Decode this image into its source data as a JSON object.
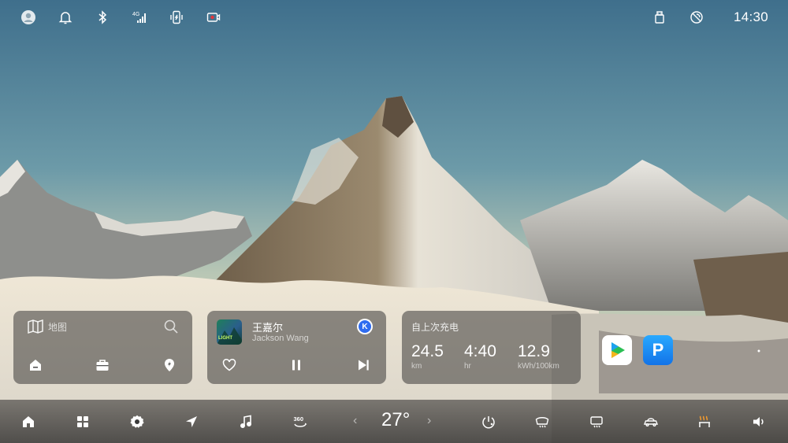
{
  "status_bar": {
    "network_label": "4G",
    "time": "14:30"
  },
  "nav_card": {
    "title": "地图",
    "shortcuts": [
      "home-icon",
      "work-briefcase-icon",
      "poi-location-icon"
    ]
  },
  "music_card": {
    "title": "王嘉尔",
    "artist": "Jackson Wang",
    "album_text": "LIGHT",
    "source_badge": "K",
    "favorite": false,
    "playing": true
  },
  "energy_card": {
    "title": "自上次充电",
    "stats": [
      {
        "value": "24.5",
        "unit": "km"
      },
      {
        "value": "4:40",
        "unit": "hr"
      },
      {
        "value": "12.9",
        "unit": "kWh/100km"
      }
    ]
  },
  "apps": {
    "video_app": "video-play-icon",
    "p_app_label": "P"
  },
  "dock": {
    "camera_label": "360",
    "temperature": "27°",
    "temp_down": "‹",
    "temp_up": "›"
  },
  "colors": {
    "card_bg": "#444240",
    "accent_blue": "#2f6cf0",
    "p_app": "#1b8df2",
    "heat_orange": "#f29a2e"
  }
}
